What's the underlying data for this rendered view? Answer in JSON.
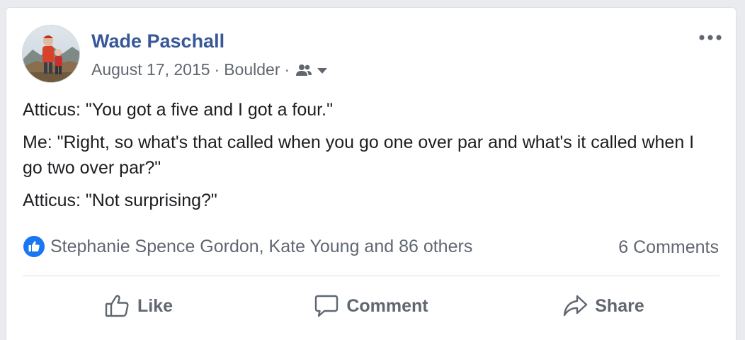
{
  "post": {
    "author": "Wade Paschall",
    "date": "August 17, 2015",
    "separator": "·",
    "location": "Boulder",
    "audience_icon": "friends-icon",
    "more_icon": "more-options-icon",
    "paragraphs": [
      "Atticus: \"You got a five and I got a four.\"",
      "Me: \"Right, so what's that called when you go one over par and what's it called when I go two over par?\"",
      "Atticus: \"Not surprising?\""
    ]
  },
  "engagement": {
    "reactions_text": "Stephanie Spence Gordon, Kate Young and 86 others",
    "comments_text": "6 Comments",
    "like_badge_icon": "like-reaction-icon"
  },
  "actions": {
    "like_label": "Like",
    "comment_label": "Comment",
    "share_label": "Share"
  },
  "colors": {
    "link_blue": "#385898",
    "like_blue": "#1877f2",
    "secondary_text": "#606770",
    "body_text": "#1c1e21"
  }
}
